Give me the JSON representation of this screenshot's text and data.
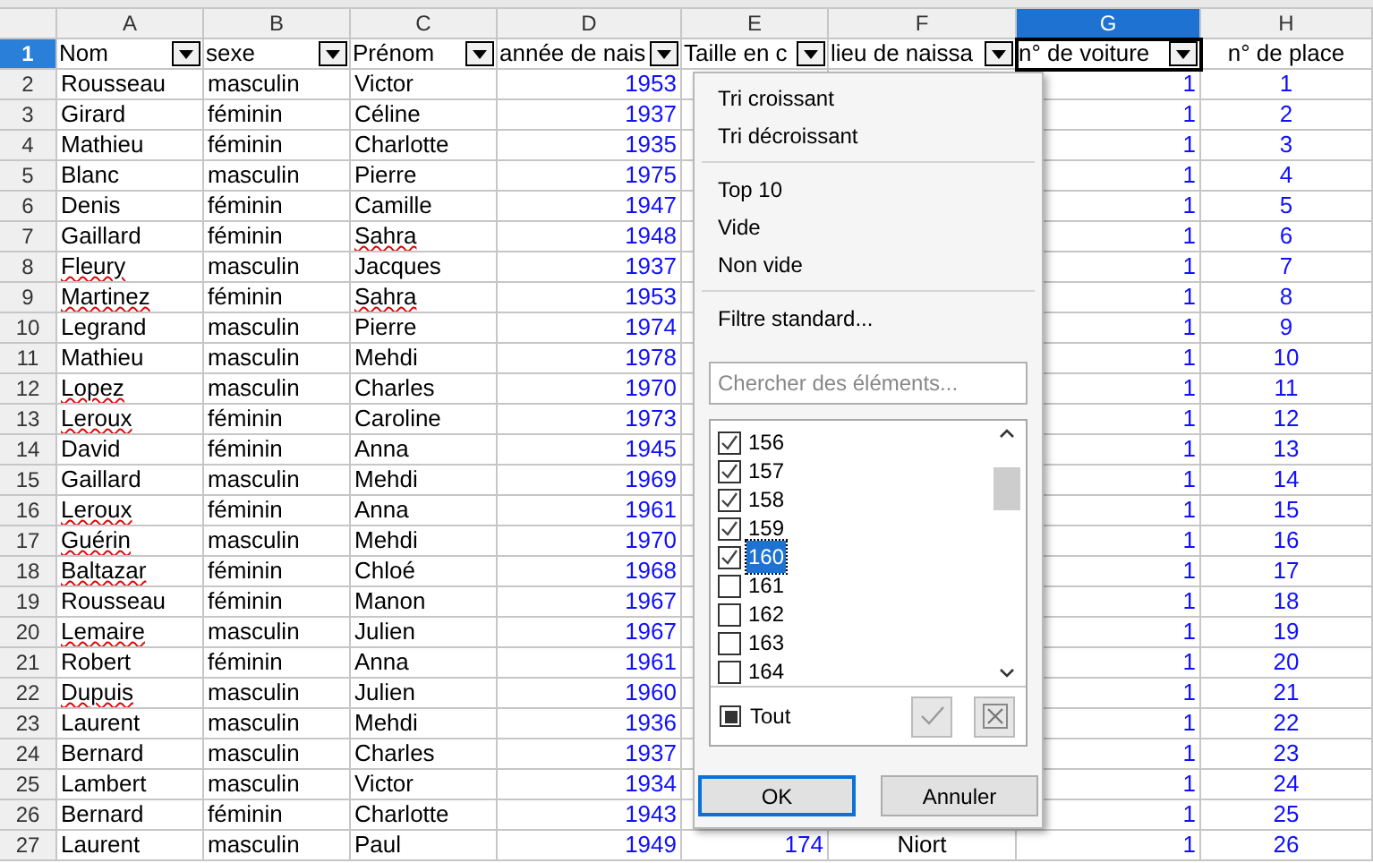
{
  "columns": [
    {
      "letter": "A",
      "selected": false
    },
    {
      "letter": "B",
      "selected": false
    },
    {
      "letter": "C",
      "selected": false
    },
    {
      "letter": "D",
      "selected": false
    },
    {
      "letter": "E",
      "selected": false
    },
    {
      "letter": "F",
      "selected": false
    },
    {
      "letter": "G",
      "selected": true
    },
    {
      "letter": "H",
      "selected": false
    }
  ],
  "header_row": {
    "num": "1",
    "cells": [
      {
        "text": "Nom",
        "filter": true
      },
      {
        "text": "sexe",
        "filter": true
      },
      {
        "text": "Prénom",
        "filter": true
      },
      {
        "text": "année de nais",
        "filter": true
      },
      {
        "text": "Taille en c",
        "filter": true
      },
      {
        "text": "lieu de naissa",
        "filter": true
      },
      {
        "text": "n° de voiture",
        "filter": true
      },
      {
        "text": "n° de place",
        "filter": false
      }
    ]
  },
  "rows": [
    {
      "num": "2",
      "nom": "Rousseau",
      "sexe": "masculin",
      "prenom": "Victor",
      "annee": "1953",
      "voiture": "1",
      "place": "1",
      "nom_flagged": false,
      "prenom_flagged": false
    },
    {
      "num": "3",
      "nom": "Girard",
      "sexe": "féminin",
      "prenom": "Céline",
      "annee": "1937",
      "voiture": "1",
      "place": "2",
      "nom_flagged": false,
      "prenom_flagged": false
    },
    {
      "num": "4",
      "nom": "Mathieu",
      "sexe": "féminin",
      "prenom": "Charlotte",
      "annee": "1935",
      "voiture": "1",
      "place": "3",
      "nom_flagged": false,
      "prenom_flagged": false
    },
    {
      "num": "5",
      "nom": "Blanc",
      "sexe": "masculin",
      "prenom": "Pierre",
      "annee": "1975",
      "voiture": "1",
      "place": "4",
      "nom_flagged": false,
      "prenom_flagged": false
    },
    {
      "num": "6",
      "nom": "Denis",
      "sexe": "féminin",
      "prenom": "Camille",
      "annee": "1947",
      "voiture": "1",
      "place": "5",
      "nom_flagged": false,
      "prenom_flagged": false
    },
    {
      "num": "7",
      "nom": "Gaillard",
      "sexe": "féminin",
      "prenom": "Sahra",
      "annee": "1948",
      "voiture": "1",
      "place": "6",
      "nom_flagged": false,
      "prenom_flagged": true
    },
    {
      "num": "8",
      "nom": "Fleury",
      "sexe": "masculin",
      "prenom": "Jacques",
      "annee": "1937",
      "voiture": "1",
      "place": "7",
      "nom_flagged": true,
      "prenom_flagged": false
    },
    {
      "num": "9",
      "nom": "Martinez",
      "sexe": "féminin",
      "prenom": "Sahra",
      "annee": "1953",
      "voiture": "1",
      "place": "8",
      "nom_flagged": true,
      "prenom_flagged": true
    },
    {
      "num": "10",
      "nom": "Legrand",
      "sexe": "masculin",
      "prenom": "Pierre",
      "annee": "1974",
      "voiture": "1",
      "place": "9",
      "nom_flagged": false,
      "prenom_flagged": false
    },
    {
      "num": "11",
      "nom": "Mathieu",
      "sexe": "masculin",
      "prenom": "Mehdi",
      "annee": "1978",
      "voiture": "1",
      "place": "10",
      "nom_flagged": false,
      "prenom_flagged": false
    },
    {
      "num": "12",
      "nom": "Lopez",
      "sexe": "masculin",
      "prenom": "Charles",
      "annee": "1970",
      "voiture": "1",
      "place": "11",
      "nom_flagged": true,
      "prenom_flagged": false
    },
    {
      "num": "13",
      "nom": "Leroux",
      "sexe": "féminin",
      "prenom": "Caroline",
      "annee": "1973",
      "voiture": "1",
      "place": "12",
      "nom_flagged": true,
      "prenom_flagged": false
    },
    {
      "num": "14",
      "nom": "David",
      "sexe": "féminin",
      "prenom": "Anna",
      "annee": "1945",
      "voiture": "1",
      "place": "13",
      "nom_flagged": false,
      "prenom_flagged": false
    },
    {
      "num": "15",
      "nom": "Gaillard",
      "sexe": "masculin",
      "prenom": "Mehdi",
      "annee": "1969",
      "voiture": "1",
      "place": "14",
      "nom_flagged": false,
      "prenom_flagged": false
    },
    {
      "num": "16",
      "nom": "Leroux",
      "sexe": "féminin",
      "prenom": "Anna",
      "annee": "1961",
      "voiture": "1",
      "place": "15",
      "nom_flagged": true,
      "prenom_flagged": false
    },
    {
      "num": "17",
      "nom": "Guérin",
      "sexe": "masculin",
      "prenom": "Mehdi",
      "annee": "1970",
      "voiture": "1",
      "place": "16",
      "nom_flagged": true,
      "prenom_flagged": false
    },
    {
      "num": "18",
      "nom": "Baltazar",
      "sexe": "féminin",
      "prenom": "Chloé",
      "annee": "1968",
      "voiture": "1",
      "place": "17",
      "nom_flagged": true,
      "prenom_flagged": false
    },
    {
      "num": "19",
      "nom": "Rousseau",
      "sexe": "féminin",
      "prenom": "Manon",
      "annee": "1967",
      "voiture": "1",
      "place": "18",
      "nom_flagged": false,
      "prenom_flagged": false
    },
    {
      "num": "20",
      "nom": "Lemaire",
      "sexe": "masculin",
      "prenom": "Julien",
      "annee": "1967",
      "voiture": "1",
      "place": "19",
      "nom_flagged": true,
      "prenom_flagged": false
    },
    {
      "num": "21",
      "nom": "Robert",
      "sexe": "féminin",
      "prenom": "Anna",
      "annee": "1961",
      "voiture": "1",
      "place": "20",
      "nom_flagged": false,
      "prenom_flagged": false
    },
    {
      "num": "22",
      "nom": "Dupuis",
      "sexe": "masculin",
      "prenom": "Julien",
      "annee": "1960",
      "voiture": "1",
      "place": "21",
      "nom_flagged": true,
      "prenom_flagged": false
    },
    {
      "num": "23",
      "nom": "Laurent",
      "sexe": "masculin",
      "prenom": "Mehdi",
      "annee": "1936",
      "voiture": "1",
      "place": "22",
      "nom_flagged": false,
      "prenom_flagged": false
    },
    {
      "num": "24",
      "nom": "Bernard",
      "sexe": "masculin",
      "prenom": "Charles",
      "annee": "1937",
      "voiture": "1",
      "place": "23",
      "nom_flagged": false,
      "prenom_flagged": false
    },
    {
      "num": "25",
      "nom": "Lambert",
      "sexe": "masculin",
      "prenom": "Victor",
      "annee": "1934",
      "voiture": "1",
      "place": "24",
      "nom_flagged": false,
      "prenom_flagged": false
    },
    {
      "num": "26",
      "nom": "Bernard",
      "sexe": "féminin",
      "prenom": "Charlotte",
      "annee": "1943",
      "voiture": "1",
      "place": "25",
      "nom_flagged": false,
      "prenom_flagged": false
    },
    {
      "num": "27",
      "nom": "Laurent",
      "sexe": "masculin",
      "prenom": "Paul",
      "annee": "1949",
      "taille": "174",
      "lieu": "Niort",
      "voiture": "1",
      "place": "26",
      "nom_flagged": false,
      "prenom_flagged": false
    }
  ],
  "filter_popup": {
    "menu_groups": [
      [
        "Tri croissant",
        "Tri décroissant"
      ],
      [
        "Top 10",
        "Vide",
        "Non vide"
      ],
      [
        "Filtre standard..."
      ]
    ],
    "search": {
      "placeholder": "Chercher des éléments..."
    },
    "values": [
      {
        "label": "156",
        "checked": true,
        "selected": false
      },
      {
        "label": "157",
        "checked": true,
        "selected": false
      },
      {
        "label": "158",
        "checked": true,
        "selected": false
      },
      {
        "label": "159",
        "checked": true,
        "selected": false
      },
      {
        "label": "160",
        "checked": true,
        "selected": true
      },
      {
        "label": "161",
        "checked": false,
        "selected": false
      },
      {
        "label": "162",
        "checked": false,
        "selected": false
      },
      {
        "label": "163",
        "checked": false,
        "selected": false
      },
      {
        "label": "164",
        "checked": false,
        "selected": false
      }
    ],
    "all": {
      "label": "Tout",
      "checked": false,
      "indeterminate": true
    },
    "buttons": [
      {
        "label": "OK",
        "default": true
      },
      {
        "label": "Annuler",
        "default": false
      }
    ]
  }
}
